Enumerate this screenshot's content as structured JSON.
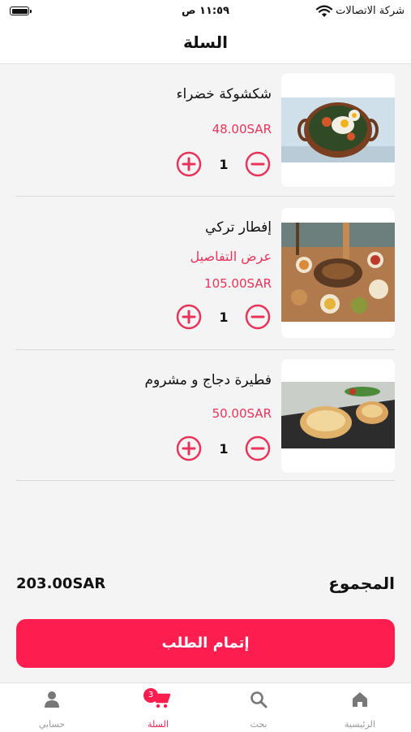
{
  "status_bar": {
    "time": "١١:٥٩ ص",
    "carrier": "شركة الاتصالات"
  },
  "header": {
    "title": "السلة"
  },
  "cart": {
    "items": [
      {
        "name": "شكشوكة خضراء",
        "price": "48.00SAR",
        "quantity": "1"
      },
      {
        "name": "إفطار تركي",
        "details_link": "عرض التفاصيل",
        "price": "105.00SAR",
        "quantity": "1"
      },
      {
        "name": "فطيرة دجاج و مشروم",
        "price": "50.00SAR",
        "quantity": "1"
      }
    ]
  },
  "summary": {
    "total_label": "المجموع",
    "total_value": "203.00SAR"
  },
  "checkout_button": {
    "label": "إتمام الطلب"
  },
  "tab_bar": {
    "tabs": [
      {
        "label": "الرئيسية",
        "icon": "home-icon"
      },
      {
        "label": "بحث",
        "icon": "search-icon"
      },
      {
        "label": "السلة",
        "icon": "cart-icon",
        "badge": "3",
        "active": true
      },
      {
        "label": "حسابي",
        "icon": "user-icon"
      }
    ]
  },
  "colors": {
    "accent": "#fd1d4f",
    "price": "#e8335a"
  }
}
